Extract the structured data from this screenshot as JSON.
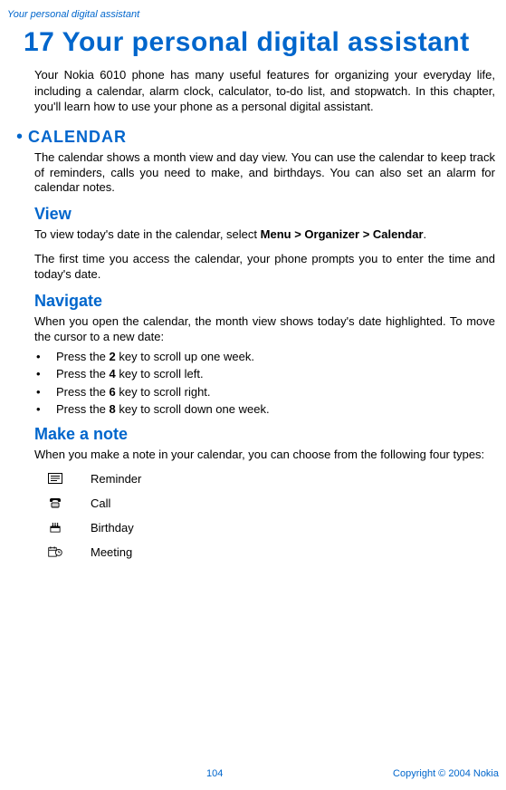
{
  "header": {
    "section_label": "Your personal digital assistant"
  },
  "chapter": {
    "number": "17",
    "title": "Your personal digital assistant",
    "intro": "Your Nokia 6010 phone has many useful features for organizing your everyday life, including a calendar, alarm clock, calculator, to-do list, and stopwatch. In this chapter, you'll learn how to use your phone as a personal digital assistant."
  },
  "calendar": {
    "heading": "CALENDAR",
    "intro": "The calendar shows a month view and day view. You can use the calendar to keep track of reminders, calls you need to make, and birthdays. You can also set an alarm for calendar notes.",
    "view": {
      "heading": "View",
      "p1a": "To view today's date in the calendar, select ",
      "p1b_bold": "Menu > Organizer > Calendar",
      "p1c": ".",
      "p2": "The first time you access the calendar, your phone prompts you to enter the time and today's date."
    },
    "navigate": {
      "heading": "Navigate",
      "intro": "When you open the calendar, the month view shows today's date highlighted. To move the cursor to a new date:",
      "items": [
        {
          "a": "Press the ",
          "key": "2",
          "b": " key to scroll up one week."
        },
        {
          "a": "Press the ",
          "key": "4",
          "b": " key to scroll left."
        },
        {
          "a": "Press the ",
          "key": "6",
          "b": " key to scroll right."
        },
        {
          "a": "Press the ",
          "key": "8",
          "b": " key to scroll down one week."
        }
      ]
    },
    "make_note": {
      "heading": "Make a note",
      "intro": "When you make a note in your calendar, you can choose from the following four types:",
      "types": [
        {
          "icon": "reminder-icon",
          "label": "Reminder"
        },
        {
          "icon": "call-icon",
          "label": "Call"
        },
        {
          "icon": "birthday-icon",
          "label": "Birthday"
        },
        {
          "icon": "meeting-icon",
          "label": "Meeting"
        }
      ]
    }
  },
  "footer": {
    "page": "104",
    "copyright": "Copyright © 2004 Nokia"
  }
}
